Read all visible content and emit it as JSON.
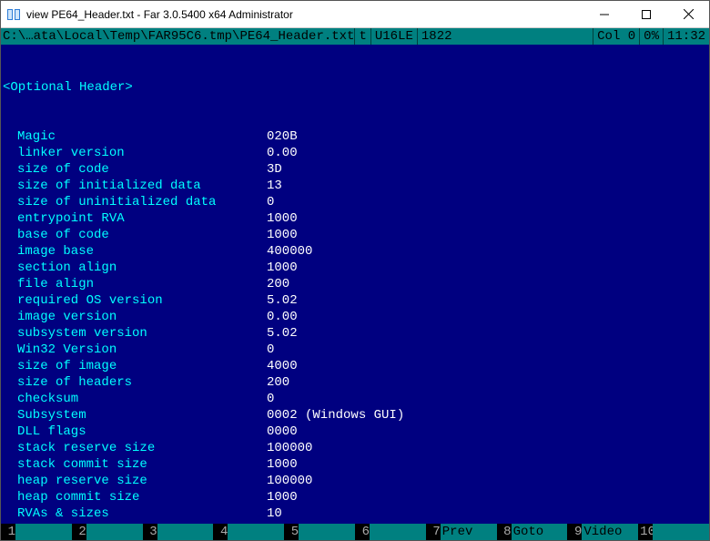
{
  "window": {
    "title": "view PE64_Header.txt - Far 3.0.5400 x64 Administrator"
  },
  "status": {
    "path": "C:\\…ata\\Local\\Temp\\FAR95C6.tmp\\PE64_Header.txt",
    "mode": "t",
    "encoding": "U16LE",
    "size": "1822",
    "col": "Col 0",
    "percent": "0%",
    "time": "11:32"
  },
  "section_title": "<Optional Header>",
  "fields": [
    {
      "label": "Magic",
      "value": "020B"
    },
    {
      "label": "linker version",
      "value": "0.00"
    },
    {
      "label": "size of code",
      "value": "3D"
    },
    {
      "label": "size of initialized data",
      "value": "13"
    },
    {
      "label": "size of uninitialized data",
      "value": "0"
    },
    {
      "label": "entrypoint RVA",
      "value": "1000"
    },
    {
      "label": "base of code",
      "value": "1000"
    },
    {
      "label": "image base",
      "value": "400000"
    },
    {
      "label": "section align",
      "value": "1000"
    },
    {
      "label": "file align",
      "value": "200"
    },
    {
      "label": "required OS version",
      "value": "5.02"
    },
    {
      "label": "image version",
      "value": "0.00"
    },
    {
      "label": "subsystem version",
      "value": "5.02"
    },
    {
      "label": "Win32 Version",
      "value": "0"
    },
    {
      "label": "size of image",
      "value": "4000"
    },
    {
      "label": "size of headers",
      "value": "200"
    },
    {
      "label": "checksum",
      "value": "0"
    },
    {
      "label": "Subsystem",
      "value": "0002 (Windows GUI)"
    },
    {
      "label": "DLL flags",
      "value": "0000"
    },
    {
      "label": "stack reserve size",
      "value": "100000"
    },
    {
      "label": "stack commit size",
      "value": "1000"
    },
    {
      "label": "heap reserve size",
      "value": "100000"
    },
    {
      "label": "heap commit size",
      "value": "1000"
    },
    {
      "label": "RVAs & sizes",
      "value": "10"
    }
  ],
  "funcs": [
    {
      "n": "1",
      "label": ""
    },
    {
      "n": "2",
      "label": ""
    },
    {
      "n": "3",
      "label": ""
    },
    {
      "n": "4",
      "label": ""
    },
    {
      "n": "5",
      "label": ""
    },
    {
      "n": "6",
      "label": ""
    },
    {
      "n": "7",
      "label": "Prev"
    },
    {
      "n": "8",
      "label": "Goto"
    },
    {
      "n": "9",
      "label": "Video"
    },
    {
      "n": "10",
      "label": ""
    }
  ]
}
